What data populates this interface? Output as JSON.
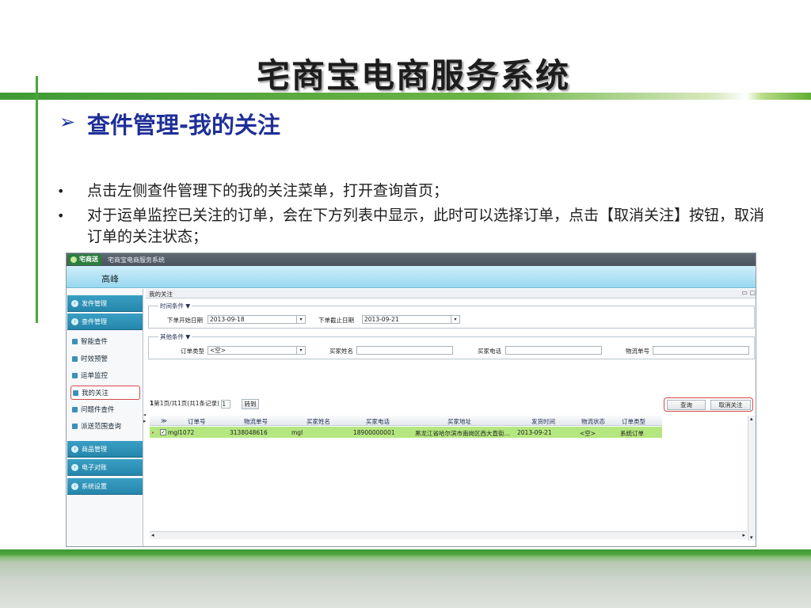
{
  "slide": {
    "title": "宅商宝电商服务系统",
    "section_arrow": "➢",
    "section_title": "查件管理-我的关注",
    "bullets": [
      "点击左侧查件管理下的我的关注菜单，打开查询首页；",
      "对于运单监控已关注的订单，会在下方列表中显示，此时可以选择订单，点击【取消关注】按钮，取消订单的关注状态；"
    ]
  },
  "app": {
    "logo": "宅商送",
    "system_name": "宅商宝电商服务系统",
    "user_name": "高峰",
    "sidebar": {
      "groups_top": [
        "发件管理",
        "查件管理"
      ],
      "items": [
        "智能查件",
        "时效预警",
        "运单监控",
        "我的关注",
        "问题件查件",
        "派送范围查询"
      ],
      "groups_bottom": [
        "商品管理",
        "电子对账",
        "系统设置"
      ],
      "collapse_arrows": "◂\n▸"
    },
    "tab": {
      "label": "我的关注",
      "controls": "▭ ▢"
    },
    "time_conditions": {
      "legend": "时间条件 ▼",
      "start_label": "下单开始日期",
      "start_value": "2013-09-18",
      "end_label": "下单截止日期",
      "end_value": "2013-09-21"
    },
    "other_conditions": {
      "legend": "其他条件 ▼",
      "order_type_label": "订单类型",
      "order_type_value": "<空>",
      "buyer_name_label": "买家姓名",
      "buyer_phone_label": "买家电话",
      "logistics_no_label": "物流单号"
    },
    "pager": {
      "current": "1",
      "text": "第1页/共1页(共1条记录)",
      "goto_value": "1",
      "goto_label": "转到"
    },
    "actions": {
      "query": "查询",
      "unfollow": "取消关注"
    },
    "grid": {
      "headers": [
        "订单号",
        "物流单号",
        "买家姓名",
        "买家电话",
        "买家地址",
        "发货时间",
        "物流状态",
        "订单类型"
      ],
      "check_header": "≫",
      "rows": [
        {
          "checked": "✓",
          "marker": "•",
          "cells": [
            "mgl1072",
            "3138048616",
            "mgl",
            "18900000001",
            "黑龙江省哈尔滨市南岗区西大直街...",
            "2013-09-21",
            "<空>",
            "系统订单"
          ]
        }
      ]
    },
    "scroll": {
      "up": "▴",
      "down": "▾",
      "left": "◂",
      "right": "▸"
    }
  }
}
